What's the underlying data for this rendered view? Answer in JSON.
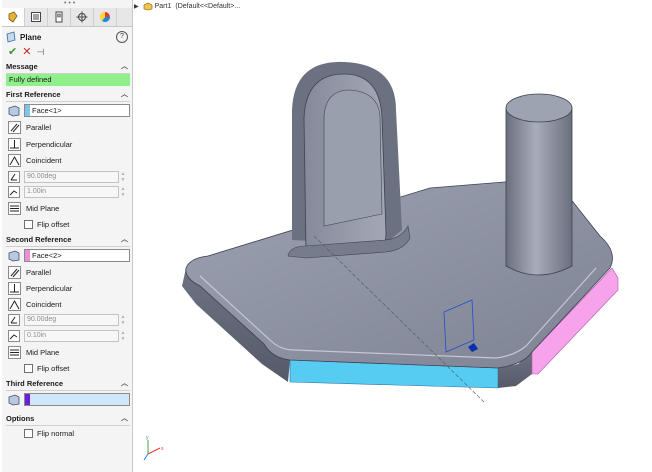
{
  "title": "Plane",
  "help_icon": "?",
  "message": {
    "header": "Message",
    "text": "Fully defined",
    "color": "#8ff08b"
  },
  "first_reference": {
    "header": "First Reference",
    "selection": "Face<1>",
    "swatch": "#7fc4ea",
    "options": [
      "Parallel",
      "Perpendicular",
      "Coincident"
    ],
    "angle": "90.00deg",
    "distance": "1.00in",
    "mid_plane": "Mid Plane",
    "flip": "Flip offset"
  },
  "second_reference": {
    "header": "Second Reference",
    "selection": "Face<2>",
    "swatch": "#ee8fd5",
    "options": [
      "Parallel",
      "Perpendicular",
      "Coincident"
    ],
    "angle": "90.00deg",
    "distance": "0.10in",
    "mid_plane": "Mid Plane",
    "flip": "Flip offset"
  },
  "third_reference": {
    "header": "Third Reference",
    "swatch": "#6b1fd6",
    "box_color": "#cfe6fb"
  },
  "options": {
    "header": "Options",
    "flip_normal": "Flip normal"
  },
  "breadcrumb": {
    "part": "Part1",
    "config": "(Default<<Default>..."
  },
  "tabs": [
    "feature-manager-icon",
    "property-manager-icon",
    "configuration-manager-icon",
    "dimxpert-icon",
    "display-manager-icon"
  ],
  "colors": {
    "face1": "#56ccf2",
    "face2": "#f7a3ec",
    "model": "#8a8f9f",
    "accent_check": "#3a9a24",
    "accent_cancel": "#c62828"
  }
}
